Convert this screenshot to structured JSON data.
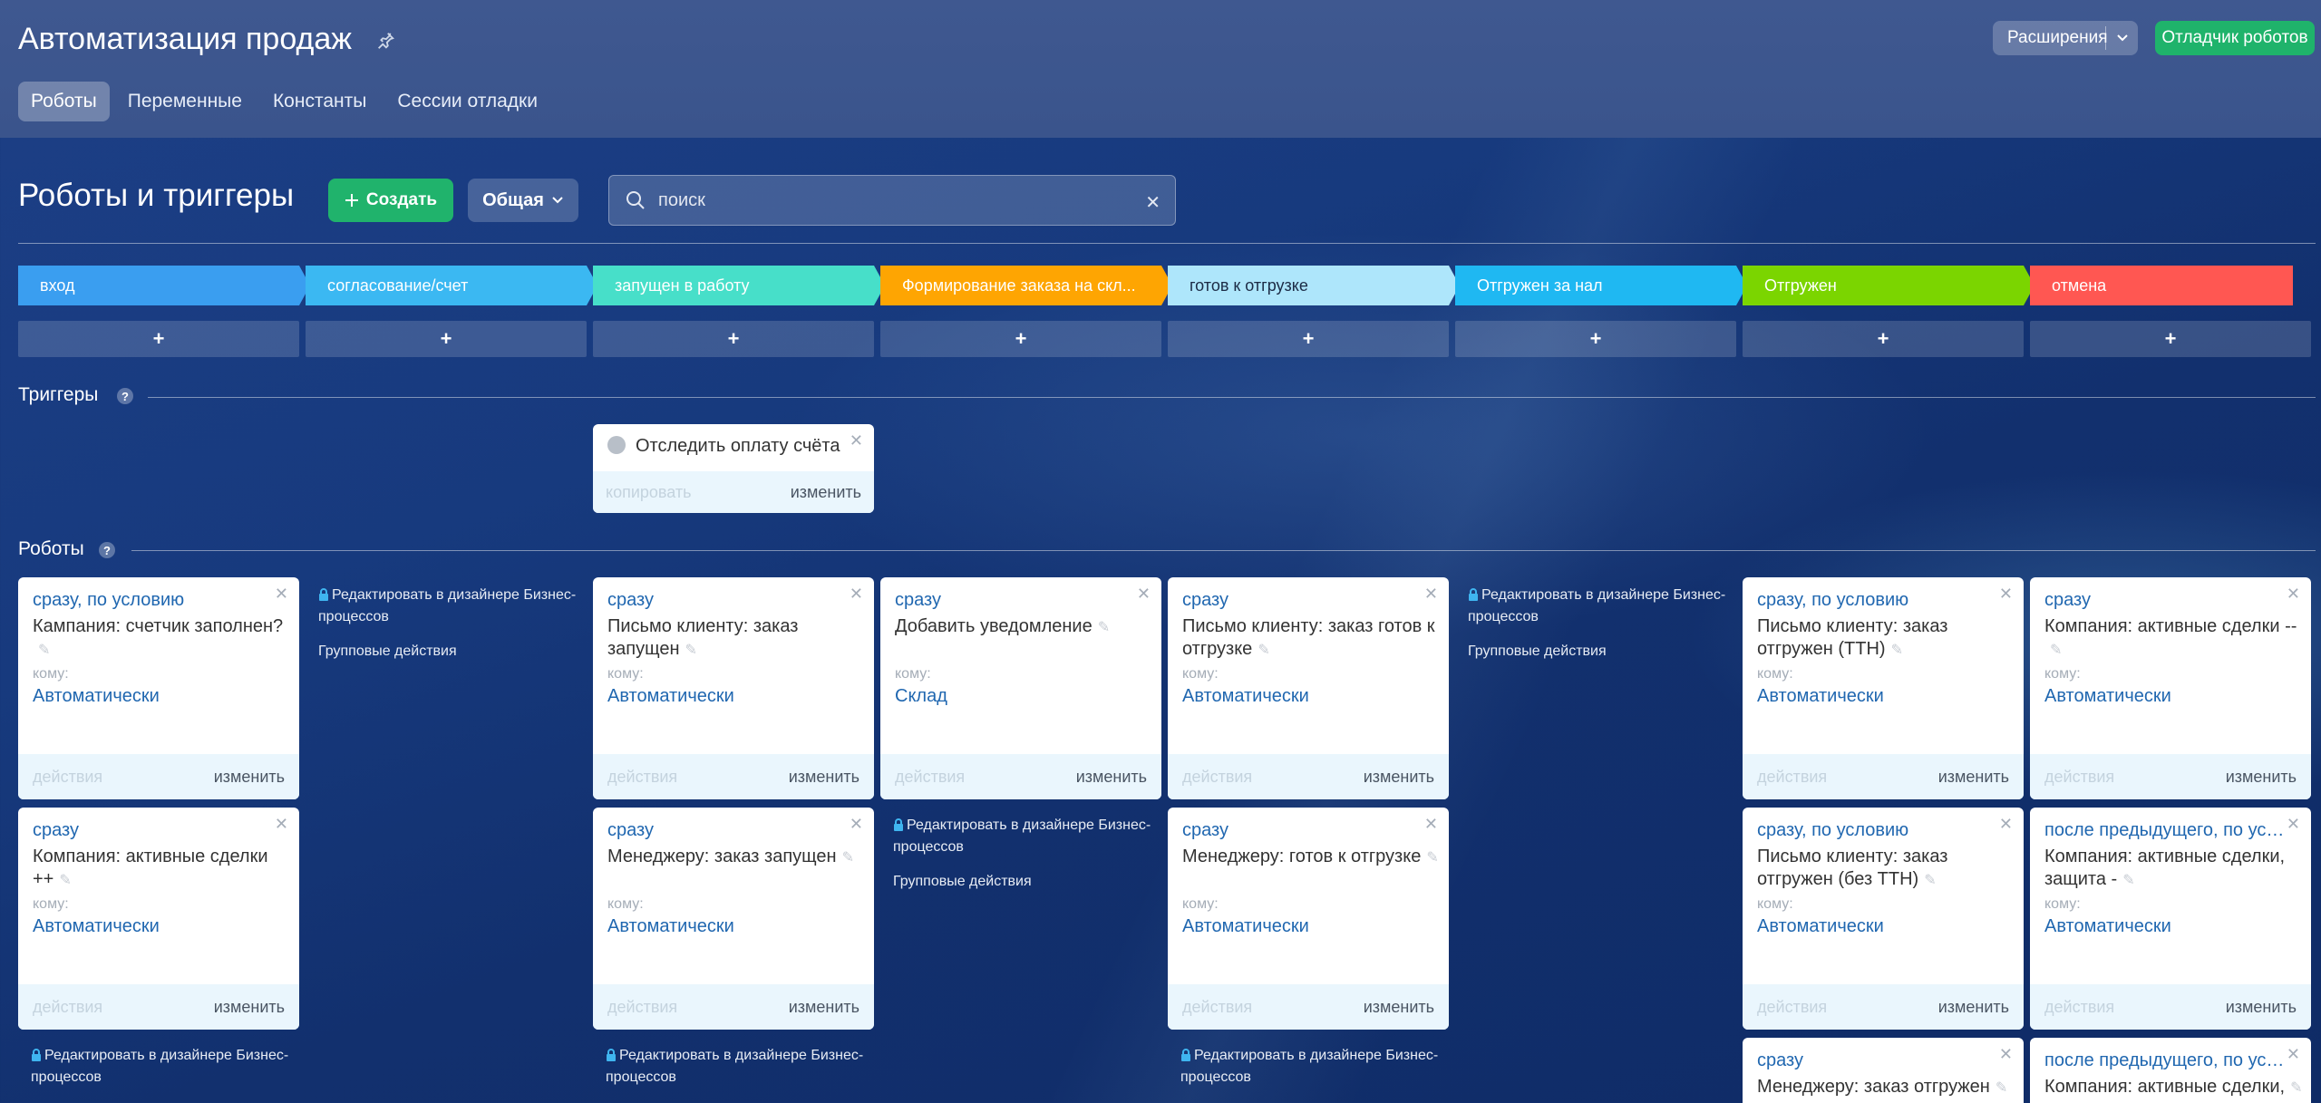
{
  "header": {
    "title": "Автоматизация продаж",
    "tabs": [
      "Роботы",
      "Переменные",
      "Константы",
      "Сессии отладки"
    ],
    "extensions_label": "Расширения",
    "debugger_label": "Отладчик роботов"
  },
  "toolbar": {
    "title": "Роботы и триггеры",
    "create_label": "Создать",
    "general_label": "Общая",
    "search_placeholder": "поиск"
  },
  "stages": [
    {
      "label": "вход",
      "color": "#3a9ef0"
    },
    {
      "label": "согласование/счет",
      "color": "#3bb8f2"
    },
    {
      "label": "запущен в работу",
      "color": "#47dfc9"
    },
    {
      "label": "Формирование заказа на скл...",
      "color": "#fea502"
    },
    {
      "label": "готов к отгрузке",
      "color": "#aee6fb"
    },
    {
      "label": "Отгружен за нал",
      "color": "#1fb8f2"
    },
    {
      "label": "Отгружен",
      "color": "#7bd500"
    },
    {
      "label": "отмена",
      "color": "#ff5752"
    }
  ],
  "add_label": "+",
  "triggers": {
    "title": "Триггеры",
    "items": [
      {
        "name": "Отследить оплату счёта",
        "copy": "копировать",
        "edit": "изменить"
      }
    ]
  },
  "robots": {
    "title": "Роботы",
    "to_label": "кому:",
    "copy_label": "действия",
    "edit_label": "изменить",
    "bp_label": "Редактировать в дизайнере Бизнес-процессов",
    "group_label": "Групповые действия",
    "cards": [
      {
        "timing": "сразу, по условию",
        "name": "Кампания: счетчик заполнен?",
        "who": "Автоматически"
      },
      {
        "timing": "сразу",
        "name": "Компания: активные сделки ++",
        "who": "Автоматически"
      },
      {
        "timing": "сразу",
        "name": "Письмо клиенту: заказ запущен",
        "who": "Автоматически"
      },
      {
        "timing": "сразу",
        "name": "Менеджеру: заказ запущен",
        "who": "Автоматически"
      },
      {
        "timing": "сразу",
        "name": "Добавить уведомление",
        "who": "Склад"
      },
      {
        "timing": "сразу",
        "name": "Письмо клиенту: заказ готов к отгрузке",
        "who": "Автоматически"
      },
      {
        "timing": "сразу",
        "name": "Менеджеру: готов к отгрузке",
        "who": "Автоматически"
      },
      {
        "timing": "сразу, по условию",
        "name": "Письмо клиенту: заказ отгружен (ТТН)",
        "who": "Автоматически"
      },
      {
        "timing": "сразу, по условию",
        "name": "Письмо клиенту: заказ отгружен (без ТТН)",
        "who": "Автоматически"
      },
      {
        "timing": "сразу",
        "name": "Менеджеру: заказ отгружен",
        "who": ""
      },
      {
        "timing": "сразу",
        "name": "Компания: активные сделки --",
        "who": "Автоматически"
      },
      {
        "timing": "после предыдущего, по усло...",
        "name": "Компания: активные сделки, защита -",
        "who": "Автоматически"
      },
      {
        "timing": "после предыдущего, по усло...",
        "name": "Компания: активные сделки,",
        "who": ""
      }
    ]
  }
}
